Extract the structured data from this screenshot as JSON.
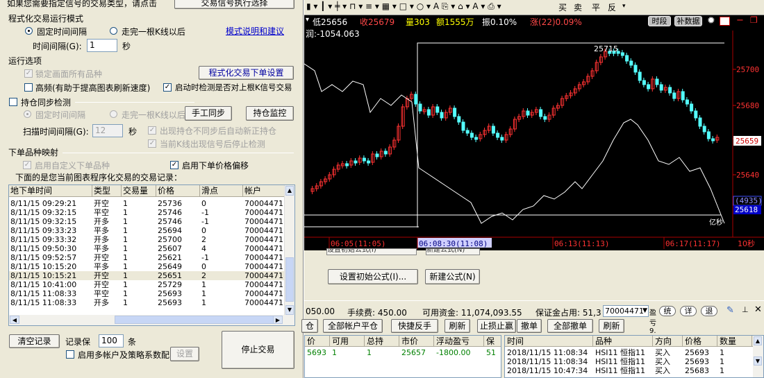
{
  "dialog": {
    "top_hint": "如果您需要指定信号的交易类型，请点击",
    "signal_button": "交易信号执行选择",
    "mode_group": "程式化交易运行模式",
    "mode_fixed": "固定时间间隔",
    "mode_bar": "走完一根K线以后",
    "mode_help_link": "模式说明和建议",
    "interval_label": "时间间隔(G):",
    "interval_value": "1",
    "interval_unit": "秒",
    "run_options": "运行选项",
    "lock_screen": "锁定画面所有品种",
    "order_settings_button": "程式化交易下单设置",
    "high_freq": "高频(有助于提高图表刷新速度)",
    "startup_check": "启动时检测是否对上根K信号交易",
    "position_sync": "持仓同步检测",
    "sync_fixed": "固定时间间隔",
    "sync_bar": "走完一根K线以后",
    "manual_sync_button": "手工同步",
    "position_monitor_button": "持仓监控",
    "scan_label": "扫描时间间隔(G):",
    "scan_value": "12",
    "scan_unit": "秒",
    "auto_correct": "出现持仓不同步后自动新正持仓",
    "stop_on_signal": "当前K线出现信号后停止检测",
    "mapping_group": "下单品种映射",
    "custom_symbol": "启用自定义下单品种",
    "price_offset": "启用下单价格偏移",
    "records_title": "下面的是您当前图表程序化交易的交易记录：",
    "clear_button": "清空记录",
    "keep_label": "记录保",
    "keep_value": "100",
    "keep_unit": "条",
    "multi_account": "启用多帐户及策略系数配",
    "settings_button": "设置",
    "stop_button": "停止交易"
  },
  "trade_table": {
    "headers": [
      "地下单时间",
      "类型",
      "交易量",
      "价格",
      "滑点",
      "帐户"
    ],
    "rows": [
      [
        "8/11/15 09:29:21",
        "开空",
        "1",
        "25736",
        "0",
        "70004471"
      ],
      [
        "8/11/15 09:32:15",
        "平空",
        "1",
        "25746",
        "-1",
        "70004471"
      ],
      [
        "8/11/15 09:32:15",
        "开多",
        "1",
        "25746",
        "-1",
        "70004471"
      ],
      [
        "8/11/15 09:33:23",
        "平多",
        "1",
        "25694",
        "0",
        "70004471"
      ],
      [
        "8/11/15 09:33:32",
        "开多",
        "1",
        "25700",
        "2",
        "70004471"
      ],
      [
        "8/11/15 09:50:30",
        "平多",
        "1",
        "25607",
        "4",
        "70004471"
      ],
      [
        "8/11/15 09:52:57",
        "开空",
        "1",
        "25621",
        "-1",
        "70004471"
      ],
      [
        "8/11/15 10:15:20",
        "平多",
        "1",
        "25649",
        "0",
        "70004471"
      ],
      [
        "8/11/15 10:15:21",
        "开空",
        "1",
        "25651",
        "2",
        "70004471"
      ],
      [
        "8/11/15 10:41:00",
        "开空",
        "1",
        "25729",
        "1",
        "70004471"
      ],
      [
        "8/11/15 11:08:33",
        "平空",
        "1",
        "25693",
        "1",
        "70004471"
      ],
      [
        "8/11/15 11:08:33",
        "开多",
        "1",
        "25693",
        "1",
        "70004471"
      ]
    ]
  },
  "toolbar": {
    "items": [
      "买",
      "卖",
      "平",
      "反"
    ]
  },
  "quote": {
    "low": "低25656",
    "close": "收25679",
    "volume": "量303",
    "amount": "额1555万",
    "amplitude": "振0.10%",
    "change": "涨(22)0.09%",
    "profit": "润:-1054.063",
    "period_button": "时段",
    "supplement_button": "补数据"
  },
  "chart_data": {
    "type": "candlestick",
    "y_ticks": [
      "25700",
      "25680",
      "25660",
      "25640"
    ],
    "current_price": "25659",
    "peak_label": "25715",
    "indicator_value": "(4935)",
    "indicator_price": "25618",
    "x_labels": [
      "06:05(11:05)",
      "06:08:30(11:08)",
      "06:13(11:13)",
      "06:17(11:17)"
    ],
    "period": "10秒",
    "marker_label": "亿秒",
    "up_color": "#ff3232",
    "down_color": "#54ffff",
    "line_color": "#ffffff"
  },
  "formula": {
    "init_button": "设置初始公式(I)...",
    "new_button": "新建公式(N)",
    "hidden_left": "设置初始公式(I)",
    "hidden_right": "新建公式(N)"
  },
  "account": {
    "balance_tail": "050.00",
    "fee": "手续费: 450.00",
    "available": "可用资金: 11,074,093.55",
    "margin": "保证金占用: 51,3",
    "account_select": "70004471",
    "tail_text": "盈亏9.",
    "chip_system": "统",
    "chip_detail": "详",
    "chip_back": "退"
  },
  "actions": {
    "left_cut": "仓",
    "all_close": "全部帐户平仓",
    "quick_reverse": "快捷反手",
    "refresh": "刷新",
    "stop_loss": "止损止赢",
    "cancel": "撤单",
    "cancel_all": "全部撤单",
    "refresh2": "刷新"
  },
  "position_table": {
    "headers": [
      "价",
      "可用",
      "总持",
      "市价",
      "浮动盈亏",
      "保"
    ],
    "row": [
      "5693",
      "1",
      "1",
      "25657",
      "-1800.00",
      "51"
    ]
  },
  "orders_table": {
    "headers": [
      "时间",
      "品种",
      "方向",
      "价格",
      "数量"
    ],
    "rows": [
      [
        "2018/11/15 11:08:34",
        "HSI11 恒指11",
        "买入",
        "25693",
        "1"
      ],
      [
        "2018/11/15 11:08:34",
        "HSI11 恒指11",
        "买入",
        "25693",
        "1"
      ],
      [
        "2018/11/15 10:47:34",
        "HSI11 恒指11",
        "买入",
        "25683",
        "1"
      ]
    ]
  }
}
